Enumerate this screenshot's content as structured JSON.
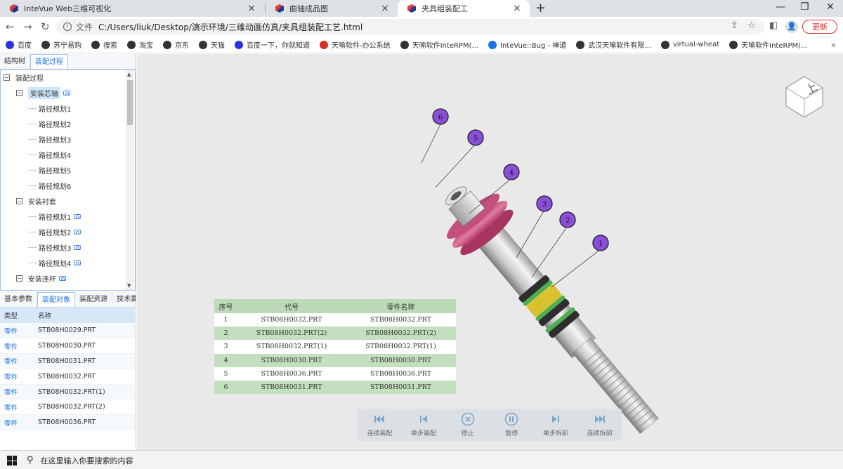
{
  "browser": {
    "tabs": [
      {
        "title": "InteVue Web三维可视化"
      },
      {
        "title": "曲轴成品图"
      },
      {
        "title": "夹具组装配工"
      }
    ],
    "address": {
      "prefix": "文件",
      "url": "C:/Users/liuk/Desktop/演示环境/三维动画仿真/夹具组装配工艺.html"
    },
    "update_label": "更新",
    "bookmarks": [
      {
        "label": "百度",
        "color": "#2932e1"
      },
      {
        "label": "苏宁易购",
        "color": "#333333"
      },
      {
        "label": "搜索",
        "color": "#333333"
      },
      {
        "label": "淘宝",
        "color": "#333333"
      },
      {
        "label": "京东",
        "color": "#333333"
      },
      {
        "label": "天猫",
        "color": "#333333"
      },
      {
        "label": "百度一下，你就知道",
        "color": "#2932e1"
      },
      {
        "label": "天喻软件-办公系统",
        "color": "#d93025"
      },
      {
        "label": "天喻软件InteRPM(...",
        "color": "#333333"
      },
      {
        "label": "InteVue::Bug - 禅道",
        "color": "#1a73e8"
      },
      {
        "label": "武汉天喻软件有限...",
        "color": "#333333"
      },
      {
        "label": "virtual-wheat",
        "color": "#333333"
      },
      {
        "label": "天喻软件InteRPM(...",
        "color": "#333333"
      }
    ]
  },
  "left_panel": {
    "tabs": [
      "结构树",
      "装配过程"
    ],
    "tree": {
      "root": "装配过程",
      "groups": [
        {
          "label": "安装芯轴",
          "selected": true,
          "camera": true,
          "children": [
            {
              "label": "路径规划1",
              "camera": false
            },
            {
              "label": "路径规划2",
              "camera": false
            },
            {
              "label": "路径规划3",
              "camera": false
            },
            {
              "label": "路径规划4",
              "camera": false
            },
            {
              "label": "路径规划5",
              "camera": false
            },
            {
              "label": "路径规划6",
              "camera": false
            }
          ]
        },
        {
          "label": "安装衬套",
          "selected": false,
          "camera": false,
          "children": [
            {
              "label": "路径规划1",
              "camera": true
            },
            {
              "label": "路径规划2",
              "camera": true
            },
            {
              "label": "路径规划3",
              "camera": true
            },
            {
              "label": "路径规划4",
              "camera": true
            }
          ]
        },
        {
          "label": "安装连杆",
          "selected": false,
          "camera": true,
          "children": []
        }
      ]
    },
    "bottom_tabs": [
      "基本参数",
      "装配对象",
      "装配资源",
      "技术要求"
    ],
    "parts_table": {
      "headers": [
        "类型",
        "名称"
      ],
      "rows": [
        {
          "type": "零件",
          "name": "STB08H0029.PRT"
        },
        {
          "type": "零件",
          "name": "STB08H0030.PRT"
        },
        {
          "type": "零件",
          "name": "STB08H0031.PRT"
        },
        {
          "type": "零件",
          "name": "STB08H0032.PRT"
        },
        {
          "type": "零件",
          "name": "STB08H0032.PRT(1)"
        },
        {
          "type": "零件",
          "name": "STB08H0032.PRT(2)"
        },
        {
          "type": "零件",
          "name": "STB08H0036.PRT"
        }
      ]
    }
  },
  "viewport": {
    "view_cube": {
      "label": "上"
    },
    "bom": {
      "headers": [
        "序号",
        "代号",
        "零件名称"
      ],
      "rows": [
        {
          "no": "1",
          "code": "STB08H0032.PRT",
          "name": "STB08H0032.PRT"
        },
        {
          "no": "2",
          "code": "STB08H0032.PRT(2)",
          "name": "STB08H0032.PRT(2)"
        },
        {
          "no": "3",
          "code": "STB08H0032.PRT(1)",
          "name": "STB08H0032.PRT(1)"
        },
        {
          "no": "4",
          "code": "STB08H0030.PRT",
          "name": "STB08H0030.PRT"
        },
        {
          "no": "5",
          "code": "STB08H0036.PRT",
          "name": "STB08H0036.PRT"
        },
        {
          "no": "6",
          "code": "STB08H0031.PRT",
          "name": "STB08H0031.PRT"
        }
      ]
    },
    "balloons": [
      "1",
      "2",
      "3",
      "4",
      "5",
      "6"
    ],
    "balloon_color": "#8a4fd8",
    "controls": [
      {
        "label": "连续装配",
        "icon": "skip-back-icon"
      },
      {
        "label": "单步装配",
        "icon": "step-back-icon"
      },
      {
        "label": "停止",
        "icon": "stop-icon"
      },
      {
        "label": "暂停",
        "icon": "pause-icon"
      },
      {
        "label": "单步拆卸",
        "icon": "step-forward-icon"
      },
      {
        "label": "连续拆卸",
        "icon": "skip-forward-icon"
      }
    ]
  },
  "taskbar": {
    "search_placeholder": "在这里输入你要搜索的内容"
  }
}
